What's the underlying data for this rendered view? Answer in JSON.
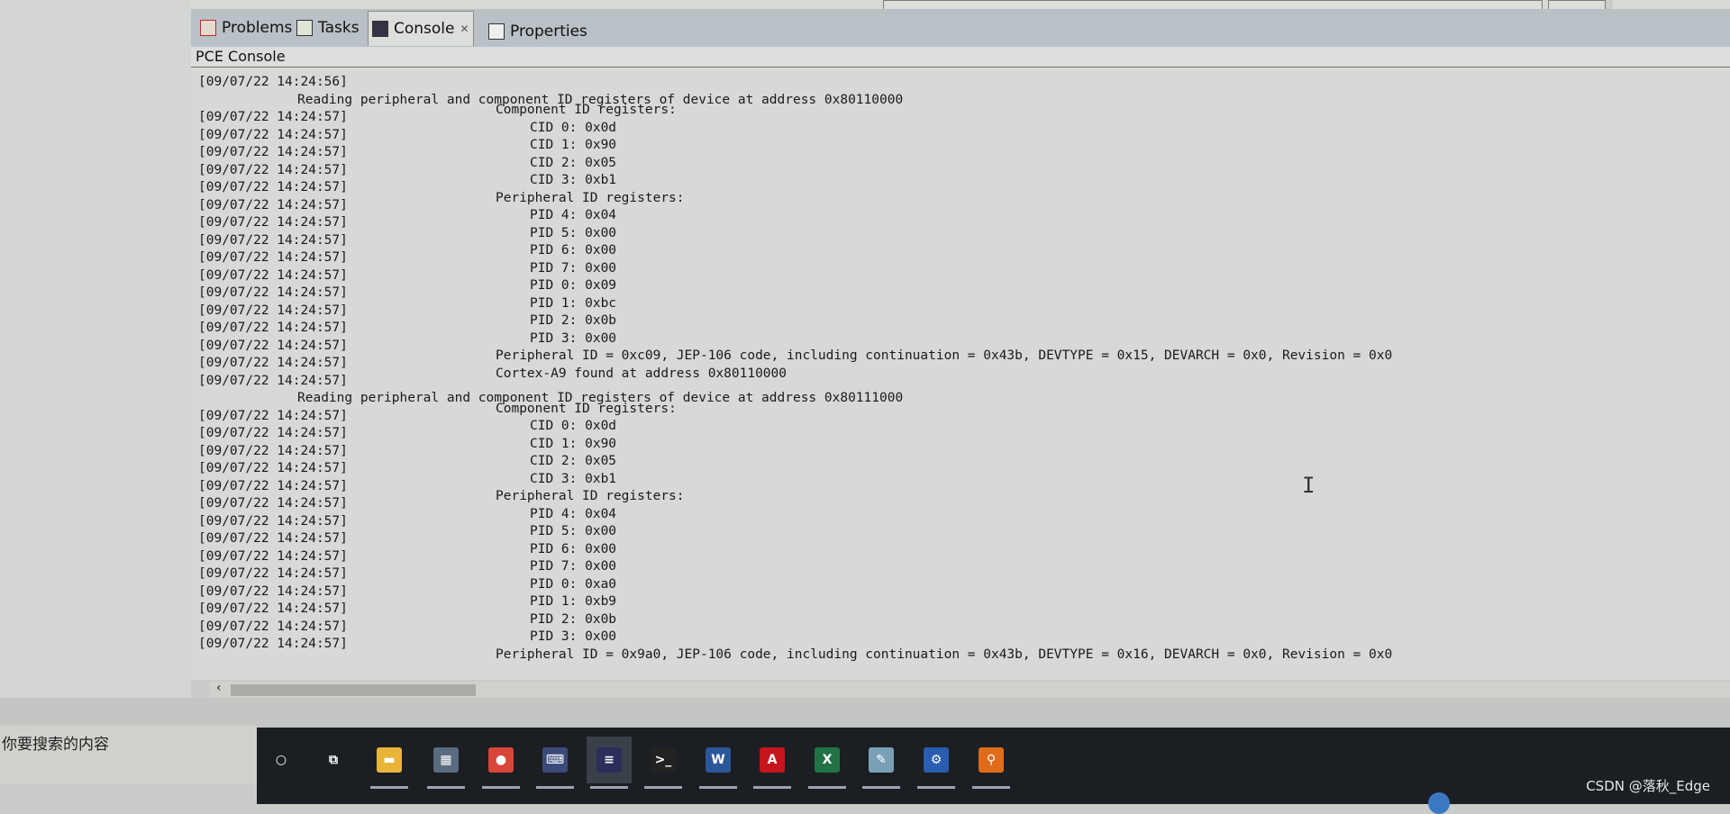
{
  "tabs": [
    {
      "label": "Problems",
      "icon": "problems-icon"
    },
    {
      "label": "Tasks",
      "icon": "tasks-icon"
    },
    {
      "label": "Console",
      "icon": "console-icon",
      "active": true,
      "close": "✕"
    },
    {
      "label": "Properties",
      "icon": "properties-icon"
    }
  ],
  "console_title": "PCE Console",
  "console_rows": [
    {
      "ts": "[09/07/22 14:24:56]",
      "msg": "",
      "indent": 0
    },
    {
      "ts": "",
      "msg": "Reading peripheral and component ID registers of device at address 0x80110000",
      "indent": 0
    },
    {
      "ts": "[09/07/22 14:24:57]",
      "msg": "Component ID registers:",
      "indent": 1
    },
    {
      "ts": "[09/07/22 14:24:57]",
      "msg": "CID 0: 0x0d",
      "indent": 2
    },
    {
      "ts": "[09/07/22 14:24:57]",
      "msg": "CID 1: 0x90",
      "indent": 2
    },
    {
      "ts": "[09/07/22 14:24:57]",
      "msg": "CID 2: 0x05",
      "indent": 2
    },
    {
      "ts": "[09/07/22 14:24:57]",
      "msg": "CID 3: 0xb1",
      "indent": 2
    },
    {
      "ts": "[09/07/22 14:24:57]",
      "msg": "Peripheral ID registers:",
      "indent": 1
    },
    {
      "ts": "[09/07/22 14:24:57]",
      "msg": "PID 4: 0x04",
      "indent": 2
    },
    {
      "ts": "[09/07/22 14:24:57]",
      "msg": "PID 5: 0x00",
      "indent": 2
    },
    {
      "ts": "[09/07/22 14:24:57]",
      "msg": "PID 6: 0x00",
      "indent": 2
    },
    {
      "ts": "[09/07/22 14:24:57]",
      "msg": "PID 7: 0x00",
      "indent": 2
    },
    {
      "ts": "[09/07/22 14:24:57]",
      "msg": "PID 0: 0x09",
      "indent": 2
    },
    {
      "ts": "[09/07/22 14:24:57]",
      "msg": "PID 1: 0xbc",
      "indent": 2
    },
    {
      "ts": "[09/07/22 14:24:57]",
      "msg": "PID 2: 0x0b",
      "indent": 2
    },
    {
      "ts": "[09/07/22 14:24:57]",
      "msg": "PID 3: 0x00",
      "indent": 2
    },
    {
      "ts": "[09/07/22 14:24:57]",
      "msg": "Peripheral ID = 0xc09, JEP-106 code, including continuation = 0x43b, DEVTYPE = 0x15, DEVARCH = 0x0, Revision = 0x0",
      "indent": 1
    },
    {
      "ts": "[09/07/22 14:24:57]",
      "msg": "Cortex-A9 found at address 0x80110000",
      "indent": 1
    },
    {
      "ts": "",
      "msg": "Reading peripheral and component ID registers of device at address 0x80111000",
      "indent": 0
    },
    {
      "ts": "[09/07/22 14:24:57]",
      "msg": "Component ID registers:",
      "indent": 1
    },
    {
      "ts": "[09/07/22 14:24:57]",
      "msg": "CID 0: 0x0d",
      "indent": 2
    },
    {
      "ts": "[09/07/22 14:24:57]",
      "msg": "CID 1: 0x90",
      "indent": 2
    },
    {
      "ts": "[09/07/22 14:24:57]",
      "msg": "CID 2: 0x05",
      "indent": 2
    },
    {
      "ts": "[09/07/22 14:24:57]",
      "msg": "CID 3: 0xb1",
      "indent": 2
    },
    {
      "ts": "[09/07/22 14:24:57]",
      "msg": "Peripheral ID registers:",
      "indent": 1
    },
    {
      "ts": "[09/07/22 14:24:57]",
      "msg": "PID 4: 0x04",
      "indent": 2
    },
    {
      "ts": "[09/07/22 14:24:57]",
      "msg": "PID 5: 0x00",
      "indent": 2
    },
    {
      "ts": "[09/07/22 14:24:57]",
      "msg": "PID 6: 0x00",
      "indent": 2
    },
    {
      "ts": "[09/07/22 14:24:57]",
      "msg": "PID 7: 0x00",
      "indent": 2
    },
    {
      "ts": "[09/07/22 14:24:57]",
      "msg": "PID 0: 0xa0",
      "indent": 2
    },
    {
      "ts": "[09/07/22 14:24:57]",
      "msg": "PID 1: 0xb9",
      "indent": 2
    },
    {
      "ts": "[09/07/22 14:24:57]",
      "msg": "PID 2: 0x0b",
      "indent": 2
    },
    {
      "ts": "[09/07/22 14:24:57]",
      "msg": "PID 3: 0x00",
      "indent": 2
    },
    {
      "ts": "",
      "msg": "Peripheral ID = 0x9a0, JEP-106 code, including continuation = 0x43b, DEVTYPE = 0x16, DEVARCH = 0x0, Revision = 0x0",
      "indent": 1
    }
  ],
  "search_placeholder": "你要搜索的内容",
  "taskbar": [
    {
      "name": "cortana",
      "glyph": "○",
      "color": "#1b1e22"
    },
    {
      "name": "task-view",
      "glyph": "⧉",
      "color": "#1b1e22"
    },
    {
      "name": "file-explorer",
      "glyph": "▬",
      "color": "#e8b53a"
    },
    {
      "name": "calculator",
      "glyph": "▦",
      "color": "#5a6b7e"
    },
    {
      "name": "chrome",
      "glyph": "●",
      "color": "#d9463a"
    },
    {
      "name": "keyboard-app",
      "glyph": "⌨",
      "color": "#3b4a7a"
    },
    {
      "name": "eclipse",
      "glyph": "≡",
      "color": "#2c2f5a",
      "active": true
    },
    {
      "name": "terminal",
      "glyph": ">_",
      "color": "#222"
    },
    {
      "name": "word",
      "glyph": "W",
      "color": "#2b579a"
    },
    {
      "name": "acrobat",
      "glyph": "A",
      "color": "#c4161c"
    },
    {
      "name": "excel",
      "glyph": "X",
      "color": "#217346"
    },
    {
      "name": "notepad",
      "glyph": "✎",
      "color": "#7aa0b8"
    },
    {
      "name": "network-tool",
      "glyph": "⚙",
      "color": "#2a5db0"
    },
    {
      "name": "search-tool",
      "glyph": "⚲",
      "color": "#e06b1a"
    }
  ],
  "watermark": "CSDN @落秋_Edge"
}
